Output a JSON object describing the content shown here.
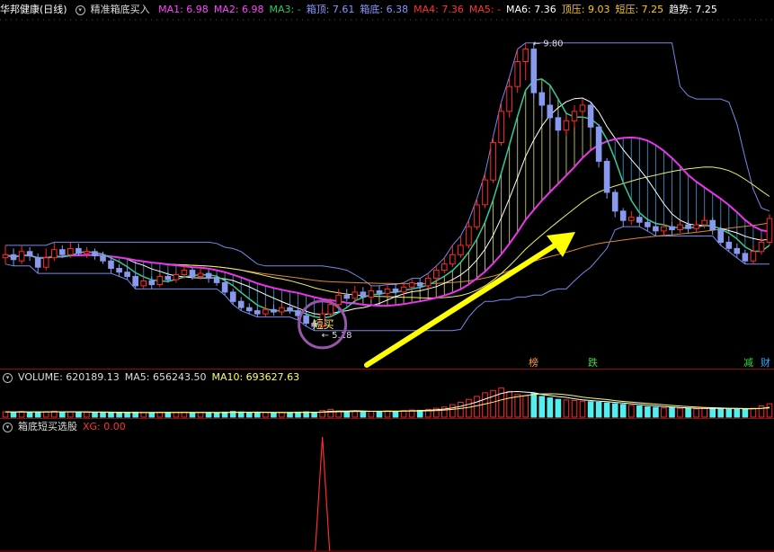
{
  "header_main": {
    "stock": "华邦健康(日线)",
    "indicator": "精准箱底买入",
    "items": [
      {
        "label": "MA1: 6.98",
        "color": "#ff44ff"
      },
      {
        "label": "MA2: 6.98",
        "color": "#ff44ff"
      },
      {
        "label": "MA3: -",
        "color": "#22cc66"
      },
      {
        "label": "箱顶: 7.61",
        "color": "#8899ff"
      },
      {
        "label": "箱底: 6.38",
        "color": "#8899ff"
      },
      {
        "label": "MA4: 7.36",
        "color": "#ff3333"
      },
      {
        "label": "MA5: -",
        "color": "#ff3333"
      },
      {
        "label": "MA6: 7.36",
        "color": "#ffffff"
      },
      {
        "label": "顶压: 9.03",
        "color": "#ffcc00"
      },
      {
        "label": "短压: 7.25",
        "color": "#ffcc00"
      },
      {
        "label": "趋势: 7.25",
        "color": "#ffffff"
      }
    ]
  },
  "header_volume": {
    "items": [
      {
        "label": "VOLUME: 620189.13",
        "color": "#dddddd"
      },
      {
        "label": "MA5: 656243.50",
        "color": "#dddddd"
      },
      {
        "label": "MA10: 693627.63",
        "color": "#ffff66"
      }
    ]
  },
  "header_signal": {
    "title": "箱底短买选股",
    "items": [
      {
        "label": "XG: 0.00",
        "color": "#ff3333"
      }
    ]
  },
  "annotations": {
    "short_buy": "短买",
    "low_price": "5.18",
    "high_price": "9.80",
    "tags": [
      {
        "text": "榜",
        "color": "#ff9933"
      },
      {
        "text": "跌",
        "color": "#33dd33"
      },
      {
        "text": "减",
        "color": "#33dd33"
      },
      {
        "text": "财",
        "color": "#33aaff"
      }
    ]
  },
  "chart_data": {
    "type": "candlestick",
    "ylim": [
      4.6,
      10.2
    ],
    "candles": [
      [
        6.35,
        6.4,
        6.55,
        6.25
      ],
      [
        6.4,
        6.32,
        6.5,
        6.22
      ],
      [
        6.3,
        6.45,
        6.55,
        6.25
      ],
      [
        6.45,
        6.38,
        6.52,
        6.3
      ],
      [
        6.35,
        6.2,
        6.42,
        6.1
      ],
      [
        6.2,
        6.35,
        6.5,
        6.15
      ],
      [
        6.35,
        6.48,
        6.6,
        6.3
      ],
      [
        6.48,
        6.4,
        6.55,
        6.35
      ],
      [
        6.4,
        6.5,
        6.6,
        6.35
      ],
      [
        6.5,
        6.42,
        6.58,
        6.38
      ],
      [
        6.42,
        6.45,
        6.52,
        6.35
      ],
      [
        6.45,
        6.38,
        6.5,
        6.32
      ],
      [
        6.38,
        6.3,
        6.45,
        6.25
      ],
      [
        6.3,
        6.18,
        6.35,
        6.1
      ],
      [
        6.18,
        6.12,
        6.25,
        6.05
      ],
      [
        6.12,
        6.05,
        6.2,
        6.0
      ],
      [
        6.05,
        5.9,
        6.1,
        5.85
      ],
      [
        5.9,
        5.98,
        6.05,
        5.85
      ],
      [
        5.98,
        5.92,
        6.05,
        5.85
      ],
      [
        5.92,
        6.05,
        6.1,
        5.88
      ],
      [
        6.05,
        6.0,
        6.12,
        5.95
      ],
      [
        6.0,
        6.08,
        6.15,
        5.95
      ],
      [
        6.08,
        6.15,
        6.22,
        6.02
      ],
      [
        6.15,
        6.05,
        6.2,
        6.0
      ],
      [
        6.05,
        6.1,
        6.18,
        6.0
      ],
      [
        6.1,
        6.02,
        6.15,
        5.95
      ],
      [
        6.02,
        5.95,
        6.08,
        5.9
      ],
      [
        5.95,
        5.8,
        6.0,
        5.75
      ],
      [
        5.8,
        5.65,
        5.85,
        5.6
      ],
      [
        5.65,
        5.55,
        5.72,
        5.5
      ],
      [
        5.55,
        5.5,
        5.62,
        5.45
      ],
      [
        5.5,
        5.45,
        5.58,
        5.4
      ],
      [
        5.45,
        5.52,
        5.6,
        5.4
      ],
      [
        5.52,
        5.48,
        5.6,
        5.42
      ],
      [
        5.48,
        5.55,
        5.62,
        5.42
      ],
      [
        5.55,
        5.5,
        5.6,
        5.45
      ],
      [
        5.5,
        5.42,
        5.55,
        5.35
      ],
      [
        5.42,
        5.3,
        5.48,
        5.25
      ],
      [
        5.3,
        5.25,
        5.35,
        5.18
      ],
      [
        5.25,
        5.45,
        5.55,
        5.2
      ],
      [
        5.45,
        5.6,
        5.7,
        5.4
      ],
      [
        5.6,
        5.75,
        5.85,
        5.55
      ],
      [
        5.75,
        5.7,
        5.85,
        5.65
      ],
      [
        5.7,
        5.8,
        5.9,
        5.65
      ],
      [
        5.8,
        5.72,
        5.88,
        5.68
      ],
      [
        5.72,
        5.82,
        5.9,
        5.68
      ],
      [
        5.82,
        5.78,
        5.9,
        5.72
      ],
      [
        5.78,
        5.85,
        5.92,
        5.72
      ],
      [
        5.85,
        5.8,
        5.92,
        5.75
      ],
      [
        5.8,
        5.88,
        5.95,
        5.75
      ],
      [
        5.88,
        5.95,
        6.02,
        5.82
      ],
      [
        5.95,
        5.9,
        6.02,
        5.85
      ],
      [
        5.9,
        6.02,
        6.1,
        5.85
      ],
      [
        6.02,
        6.15,
        6.22,
        5.98
      ],
      [
        6.15,
        6.25,
        6.35,
        6.1
      ],
      [
        6.25,
        6.4,
        6.55,
        6.2
      ],
      [
        6.4,
        6.55,
        6.7,
        6.35
      ],
      [
        6.55,
        6.85,
        6.95,
        6.5
      ],
      [
        6.85,
        7.2,
        7.3,
        6.8
      ],
      [
        7.2,
        7.6,
        7.7,
        7.15
      ],
      [
        7.6,
        8.2,
        8.3,
        7.55
      ],
      [
        8.2,
        8.7,
        8.85,
        8.15
      ],
      [
        8.7,
        9.1,
        9.25,
        8.6
      ],
      [
        9.1,
        9.5,
        9.7,
        9.0
      ],
      [
        9.5,
        9.7,
        9.8,
        9.2
      ],
      [
        9.7,
        9.0,
        9.8,
        8.9
      ],
      [
        9.0,
        8.8,
        9.1,
        8.6
      ],
      [
        8.8,
        8.6,
        8.95,
        8.45
      ],
      [
        8.6,
        8.4,
        8.7,
        8.3
      ],
      [
        8.4,
        8.55,
        8.65,
        8.3
      ],
      [
        8.55,
        8.7,
        8.8,
        8.45
      ],
      [
        8.7,
        8.8,
        8.9,
        8.6
      ],
      [
        8.8,
        8.45,
        8.85,
        8.3
      ],
      [
        8.45,
        7.9,
        8.5,
        7.8
      ],
      [
        7.9,
        7.4,
        7.95,
        7.3
      ],
      [
        7.4,
        7.1,
        7.45,
        7.0
      ],
      [
        7.1,
        6.95,
        7.15,
        6.85
      ],
      [
        6.95,
        7.0,
        7.1,
        6.88
      ],
      [
        7.0,
        6.92,
        7.05,
        6.85
      ],
      [
        6.92,
        6.85,
        6.98,
        6.78
      ],
      [
        6.85,
        6.78,
        6.92,
        6.7
      ],
      [
        6.78,
        6.85,
        6.92,
        6.7
      ],
      [
        6.85,
        6.8,
        6.92,
        6.72
      ],
      [
        6.8,
        6.88,
        6.95,
        6.75
      ],
      [
        6.88,
        6.82,
        6.95,
        6.75
      ],
      [
        6.82,
        6.88,
        6.95,
        6.75
      ],
      [
        6.88,
        6.95,
        7.05,
        6.82
      ],
      [
        6.95,
        6.8,
        7.0,
        6.72
      ],
      [
        6.8,
        6.6,
        6.85,
        6.55
      ],
      [
        6.6,
        6.5,
        6.7,
        6.45
      ],
      [
        6.5,
        6.42,
        6.58,
        6.35
      ],
      [
        6.42,
        6.3,
        6.48,
        6.25
      ],
      [
        6.3,
        6.45,
        6.55,
        6.25
      ],
      [
        6.45,
        6.6,
        6.7,
        6.4
      ],
      [
        6.6,
        6.98,
        7.05,
        6.55
      ]
    ],
    "volume": [
      180,
      170,
      190,
      160,
      175,
      185,
      200,
      165,
      178,
      170,
      160,
      155,
      168,
      150,
      145,
      160,
      170,
      150,
      155,
      165,
      158,
      162,
      170,
      150,
      160,
      150,
      145,
      170,
      190,
      175,
      160,
      150,
      165,
      150,
      160,
      155,
      170,
      180,
      160,
      220,
      260,
      200,
      190,
      210,
      180,
      200,
      190,
      210,
      195,
      220,
      240,
      230,
      260,
      300,
      340,
      420,
      500,
      600,
      700,
      820,
      900,
      980,
      860,
      760,
      720,
      800,
      700,
      650,
      600,
      580,
      560,
      540,
      520,
      500,
      480,
      450,
      430,
      400,
      380,
      350,
      330,
      310,
      320,
      300,
      290,
      280,
      300,
      310,
      290,
      280,
      270,
      260,
      300,
      380,
      450
    ],
    "volume_max": 1000,
    "signal_peak_index": 39
  }
}
